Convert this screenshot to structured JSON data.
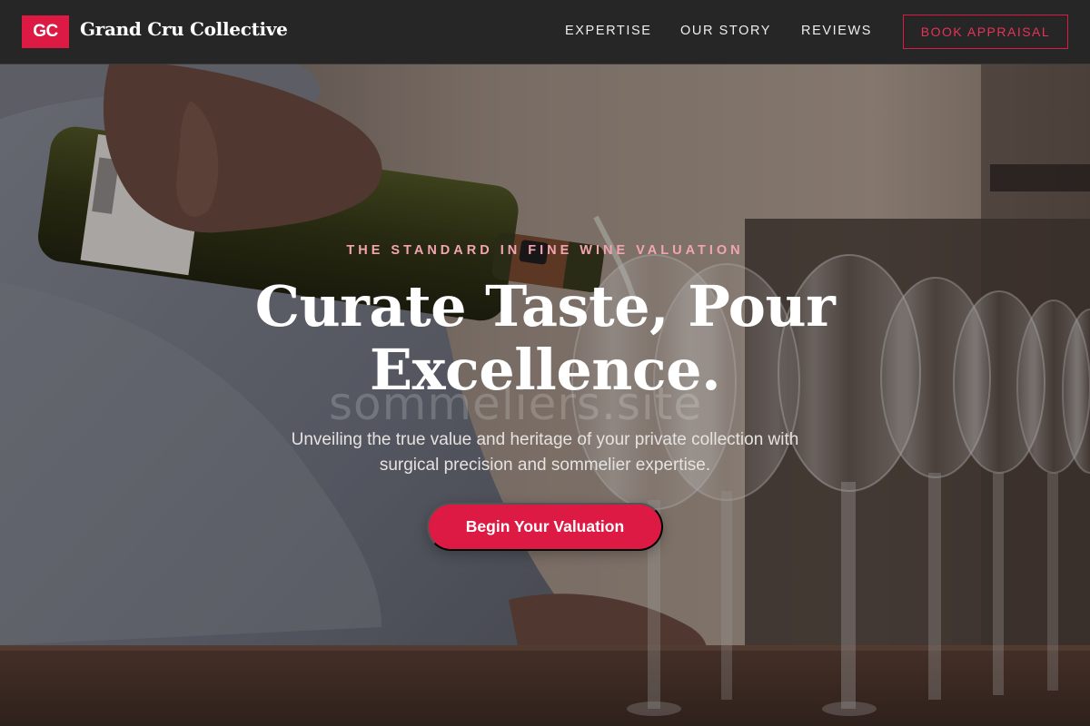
{
  "header": {
    "logo_initials": "GC",
    "brand_name": "Grand Cru Collective",
    "nav": [
      {
        "label": "EXPERTISE"
      },
      {
        "label": "OUR STORY"
      },
      {
        "label": "REVIEWS"
      }
    ],
    "cta_label": "BOOK APPRAISAL"
  },
  "hero": {
    "eyebrow": "THE STANDARD IN FINE WINE VALUATION",
    "headline_line1": "Curate Taste, Pour",
    "headline_line2": "Excellence.",
    "subcopy_line1": "Unveiling the true value and heritage of your private collection with",
    "subcopy_line2": "surgical precision and sommelier expertise.",
    "cta_label": "Begin Your Valuation",
    "watermark": "sommeliers.site",
    "background_image": "wine-pouring-photo"
  },
  "colors": {
    "accent": "#dc1a43",
    "header_bg": "#262626",
    "eyebrow": "#f2a5b0",
    "text_light": "#ffffff"
  }
}
